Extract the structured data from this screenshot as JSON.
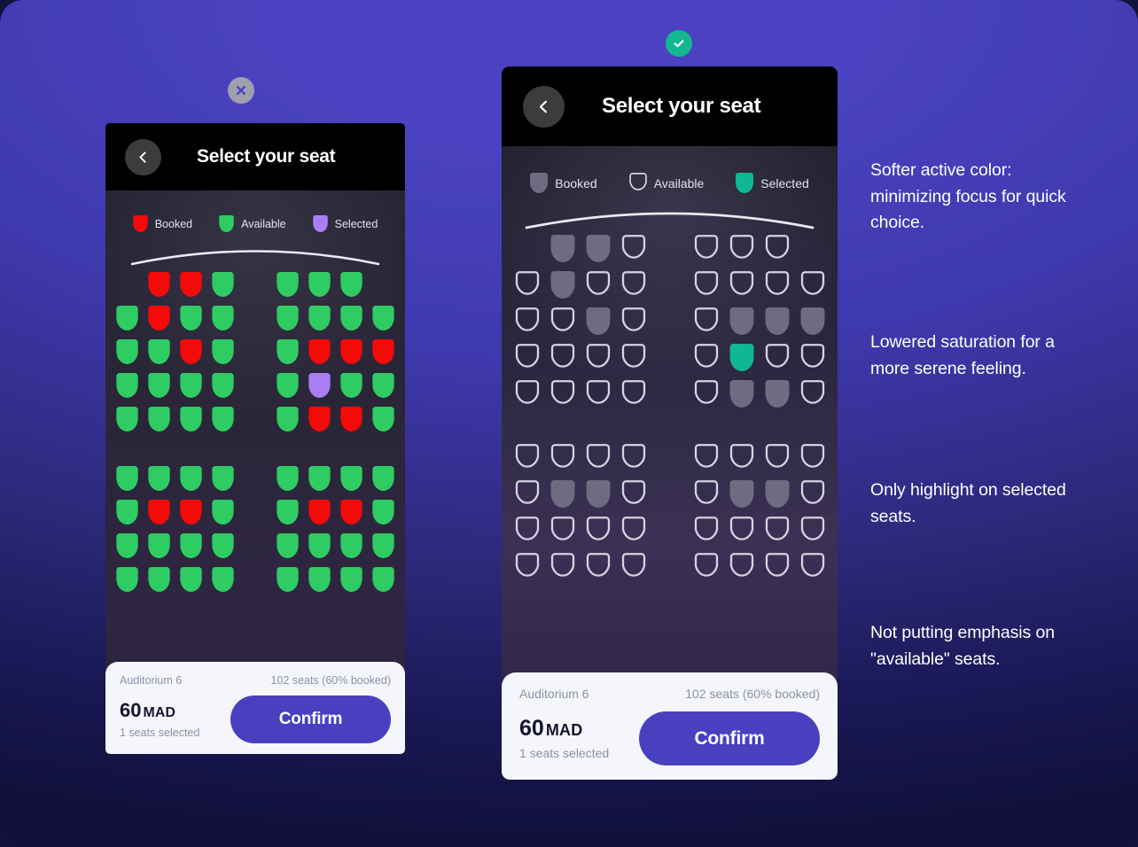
{
  "badges": {
    "left": {
      "icon": "close-icon",
      "color": "#9f9fae"
    },
    "right": {
      "icon": "check-icon",
      "color": "#11b890"
    }
  },
  "colors": {
    "background_top": "#4a42c0",
    "background_bottom": "#10103a",
    "confirm_button": "#4840bf",
    "left_booked": "#f50909",
    "left_available": "#2ecc62",
    "left_selected": "#a97ef5",
    "right_booked": "#6e6c82",
    "right_available_stroke": "#d6d4e2",
    "right_selected": "#0fb792"
  },
  "left_phone": {
    "header": {
      "title": "Select your seat",
      "back_icon": "chevron-left-icon"
    },
    "legend": [
      {
        "label": "Booked",
        "state": "booked"
      },
      {
        "label": "Available",
        "state": "available"
      },
      {
        "label": "Selected",
        "state": "selected"
      }
    ],
    "bottom_bar": {
      "venue": "Auditorium 6",
      "capacity": "102 seats (60% booked)",
      "price": "60",
      "currency": "MAD",
      "seats_selected": "1 seats selected",
      "confirm_label": "Confirm"
    }
  },
  "right_phone": {
    "header": {
      "title": "Select your seat",
      "back_icon": "chevron-left-icon"
    },
    "legend": [
      {
        "label": "Booked",
        "state": "booked"
      },
      {
        "label": "Available",
        "state": "available"
      },
      {
        "label": "Selected",
        "state": "selected"
      }
    ],
    "bottom_bar": {
      "venue": "Auditorium 6",
      "capacity": "102 seats (60% booked)",
      "price": "60",
      "currency": "MAD",
      "seats_selected": "1 seats selected",
      "confirm_label": "Confirm"
    }
  },
  "seat_grid": {
    "columns_per_block": 4,
    "blocks": 2,
    "gap_after_row": 5,
    "legend_states": [
      "empty",
      "booked",
      "available",
      "selected"
    ],
    "rows": [
      {
        "left": [
          "empty",
          "booked",
          "booked",
          "available"
        ],
        "right": [
          "available",
          "available",
          "available",
          "empty"
        ]
      },
      {
        "left": [
          "available",
          "booked",
          "available",
          "available"
        ],
        "right": [
          "available",
          "available",
          "available",
          "available"
        ]
      },
      {
        "left": [
          "available",
          "available",
          "booked",
          "available"
        ],
        "right": [
          "available",
          "booked",
          "booked",
          "booked"
        ]
      },
      {
        "left": [
          "available",
          "available",
          "available",
          "available"
        ],
        "right": [
          "available",
          "selected",
          "available",
          "available"
        ]
      },
      {
        "left": [
          "available",
          "available",
          "available",
          "available"
        ],
        "right": [
          "available",
          "booked",
          "booked",
          "available"
        ]
      },
      {
        "left": [
          "available",
          "available",
          "available",
          "available"
        ],
        "right": [
          "available",
          "available",
          "available",
          "available"
        ]
      },
      {
        "left": [
          "available",
          "booked",
          "booked",
          "available"
        ],
        "right": [
          "available",
          "booked",
          "booked",
          "available"
        ]
      },
      {
        "left": [
          "available",
          "available",
          "available",
          "available"
        ],
        "right": [
          "available",
          "available",
          "available",
          "available"
        ]
      },
      {
        "left": [
          "available",
          "available",
          "available",
          "available"
        ],
        "right": [
          "available",
          "available",
          "available",
          "available"
        ]
      }
    ]
  },
  "annotations": [
    "Softer active color: minimizing focus for quick choice.",
    "Lowered saturation for a more serene feeling.",
    "Only highlight on selected seats.",
    "Not putting emphasis on \"available\" seats."
  ]
}
